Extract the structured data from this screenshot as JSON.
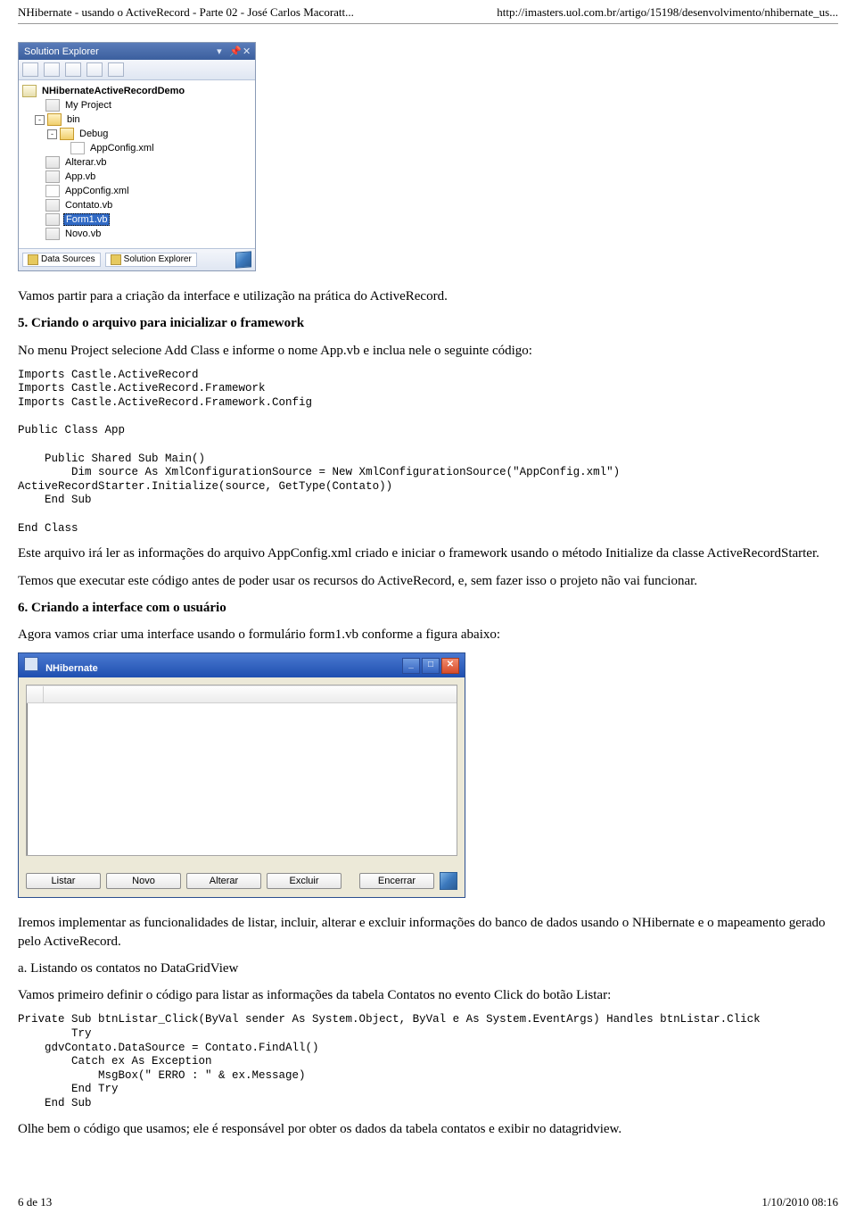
{
  "header": {
    "left": "NHibernate - usando o ActiveRecord - Parte 02 - José Carlos Macoratt...",
    "right": "http://imasters.uol.com.br/artigo/15198/desenvolvimento/nhibernate_us..."
  },
  "solution_explorer": {
    "title": "Solution Explorer",
    "project": "NHibernateActiveRecordDemo",
    "items": {
      "myproject": "My Project",
      "bin": "bin",
      "debug": "Debug",
      "appconfig_xml": "AppConfig.xml",
      "alterar_vb": "Alterar.vb",
      "app_vb": "App.vb",
      "appconfig_xml2": "AppConfig.xml",
      "contato_vb": "Contato.vb",
      "form1_vb": "Form1.vb",
      "novo_vb": "Novo.vb"
    },
    "tabs": {
      "data_sources": "Data Sources",
      "solution_explorer": "Solution Explorer"
    }
  },
  "para1": "Vamos partir para a criação da interface e utilização na prática do ActiveRecord.",
  "h5": "5. Criando o arquivo para inicializar o framework",
  "para2": "No menu Project selecione Add Class e informe o nome App.vb e inclua nele o seguinte código:",
  "code1": "Imports Castle.ActiveRecord\nImports Castle.ActiveRecord.Framework\nImports Castle.ActiveRecord.Framework.Config\n\nPublic Class App\n\n    Public Shared Sub Main()\n        Dim source As XmlConfigurationSource = New XmlConfigurationSource(\"AppConfig.xml\")\nActiveRecordStarter.Initialize(source, GetType(Contato))\n    End Sub\n\nEnd Class",
  "para3": "Este arquivo irá ler as informações do arquivo AppConfig.xml criado e iniciar o framework usando o método Initialize da classe ActiveRecordStarter.",
  "para4": "Temos que executar este código antes de poder usar os recursos do ActiveRecord, e, sem fazer isso o projeto não vai funcionar.",
  "h6": "6. Criando a interface com o usuário",
  "para5": "Agora vamos criar uma interface usando o formulário form1.vb conforme a figura abaixo:",
  "formwin": {
    "title": "NHibernate",
    "buttons": {
      "listar": "Listar",
      "novo": "Novo",
      "alterar": "Alterar",
      "excluir": "Excluir",
      "encerrar": "Encerrar"
    }
  },
  "para6": "Iremos implementar as funcionalidades de listar, incluir, alterar e excluir informações do banco de dados usando o NHibernate e o mapeamento gerado pelo ActiveRecord.",
  "para7": "a. Listando os contatos no DataGridView",
  "para8": "Vamos primeiro definir o código para listar as informações da tabela Contatos no evento Click do botão Listar:",
  "code2": "Private Sub btnListar_Click(ByVal sender As System.Object, ByVal e As System.EventArgs) Handles btnListar.Click\n        Try\n    gdvContato.DataSource = Contato.FindAll()\n        Catch ex As Exception\n            MsgBox(\" ERRO : \" & ex.Message)\n        End Try\n    End Sub",
  "para9": "Olhe bem o código que usamos; ele é responsável por obter os dados da tabela contatos e exibir no datagridview.",
  "footer": {
    "left": "6 de 13",
    "right": "1/10/2010 08:16"
  }
}
